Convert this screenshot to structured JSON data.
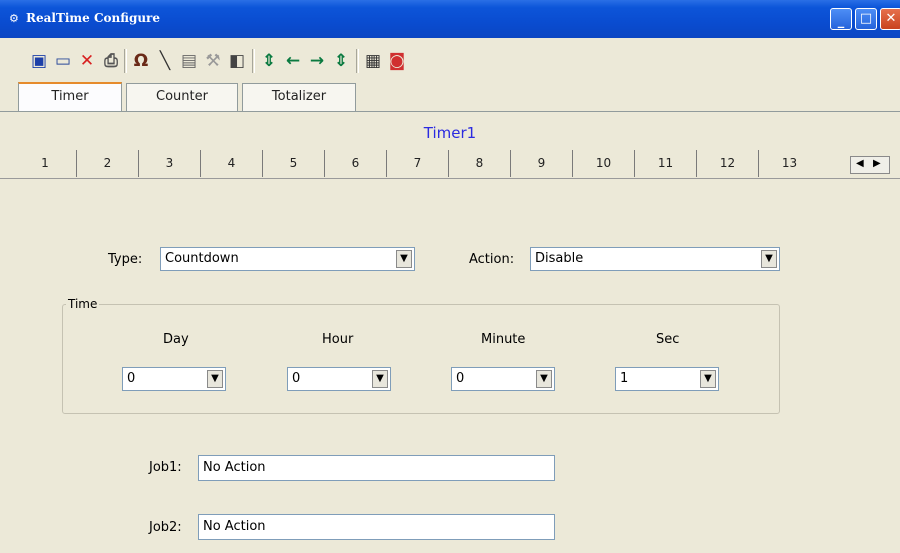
{
  "window": {
    "title": "RealTime Configure",
    "controls": {
      "minimize": "_",
      "maximize": "□",
      "close": "✕"
    }
  },
  "toolbar": {
    "icons": [
      {
        "name": "save-icon",
        "glyph": "▣",
        "color": "#1c3fa8"
      },
      {
        "name": "window-icon",
        "glyph": "▭",
        "color": "#2a4a9a"
      },
      {
        "name": "delete-icon",
        "glyph": "✕",
        "color": "#d82020"
      },
      {
        "name": "print-icon",
        "glyph": "⎙",
        "color": "#555555"
      },
      {
        "name": "magnet-icon",
        "glyph": "Ω",
        "color": "#6a2a18"
      },
      {
        "name": "line-tool-icon",
        "glyph": "╲",
        "color": "#333333"
      },
      {
        "name": "document-icon",
        "glyph": "▤",
        "color": "#666666"
      },
      {
        "name": "tool-icon",
        "glyph": "⚒",
        "color": "#999999"
      },
      {
        "name": "page-icon",
        "glyph": "◧",
        "color": "#444444"
      },
      {
        "name": "align-icon",
        "glyph": "⇕",
        "color": "#0a7a40"
      },
      {
        "name": "move-left-icon",
        "glyph": "←",
        "color": "#0a7a40"
      },
      {
        "name": "move-right-icon",
        "glyph": "→",
        "color": "#0a7a40"
      },
      {
        "name": "distribute-icon",
        "glyph": "⇕",
        "color": "#0a7a40"
      },
      {
        "name": "chip-icon",
        "glyph": "▦",
        "color": "#333333"
      },
      {
        "name": "stop-icon",
        "glyph": "◙",
        "color": "#d03030"
      }
    ]
  },
  "main_tabs": [
    "Timer",
    "Counter",
    "Totalizer"
  ],
  "timer_title": "Timer1",
  "number_tabs": [
    "1",
    "2",
    "3",
    "4",
    "5",
    "6",
    "7",
    "8",
    "9",
    "10",
    "11",
    "12",
    "13"
  ],
  "scroll": {
    "left": "◀",
    "right": "▶"
  },
  "form": {
    "type_label": "Type:",
    "type_value": "Countdown",
    "action_label": "Action:",
    "action_value": "Disable",
    "time_group": "Time",
    "day_label": "Day",
    "day_value": "0",
    "hour_label": "Hour",
    "hour_value": "0",
    "minute_label": "Minute",
    "minute_value": "0",
    "sec_label": "Sec",
    "sec_value": "1",
    "job1_label": "Job1:",
    "job1_value": "No Action",
    "job2_label": "Job2:",
    "job2_value": "No Action"
  },
  "dropdown_arrow": "▼"
}
